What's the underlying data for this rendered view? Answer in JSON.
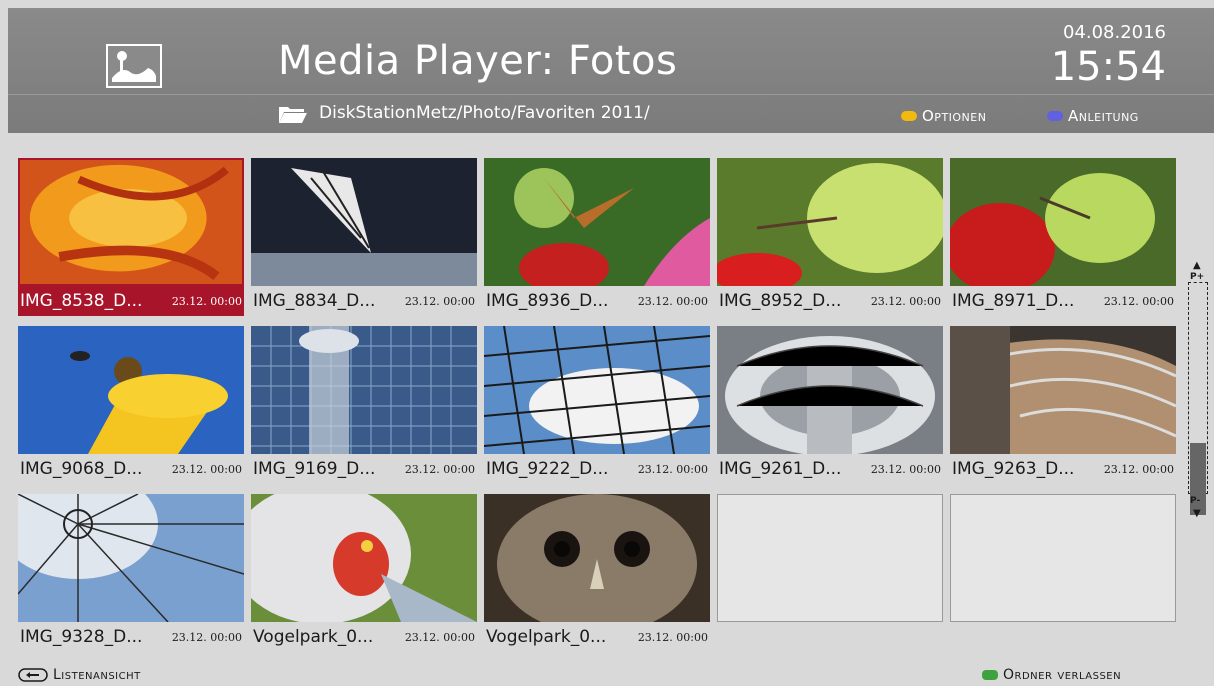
{
  "header": {
    "title": "Media Player: Fotos",
    "date": "04.08.2016",
    "time": "15:54",
    "path": "DiskStationMetz/Photo/Favoriten 2011/",
    "options_label": "Optionen",
    "guide_label": "Anleitung",
    "options_color": "#f2b90f",
    "guide_color": "#6060e0"
  },
  "tiles": [
    {
      "name": "IMG_8538_D...",
      "ts": "23.12. 00:00",
      "selected": true
    },
    {
      "name": "IMG_8834_D...",
      "ts": "23.12. 00:00"
    },
    {
      "name": "IMG_8936_D...",
      "ts": "23.12. 00:00"
    },
    {
      "name": "IMG_8952_D...",
      "ts": "23.12. 00:00"
    },
    {
      "name": "IMG_8971_D...",
      "ts": "23.12. 00:00"
    },
    {
      "name": "IMG_9068_D...",
      "ts": "23.12. 00:00"
    },
    {
      "name": "IMG_9169_D...",
      "ts": "23.12. 00:00"
    },
    {
      "name": "IMG_9222_D...",
      "ts": "23.12. 00:00"
    },
    {
      "name": "IMG_9261_D...",
      "ts": "23.12. 00:00"
    },
    {
      "name": "IMG_9263_D...",
      "ts": "23.12. 00:00"
    },
    {
      "name": "IMG_9328_D...",
      "ts": "23.12. 00:00"
    },
    {
      "name": "Vogelpark_0...",
      "ts": "23.12. 00:00"
    },
    {
      "name": "Vogelpark_0...",
      "ts": "23.12. 00:00"
    }
  ],
  "scrollbar": {
    "up_label": "P+",
    "down_label": "P-"
  },
  "footer": {
    "list_view_label": "Listenansicht",
    "leave_folder_label": "Ordner verlassen",
    "leave_folder_color": "#3ea33e"
  },
  "icons": {
    "app": "photo-icon",
    "folder": "folder-open-icon",
    "back": "back-button-icon"
  }
}
